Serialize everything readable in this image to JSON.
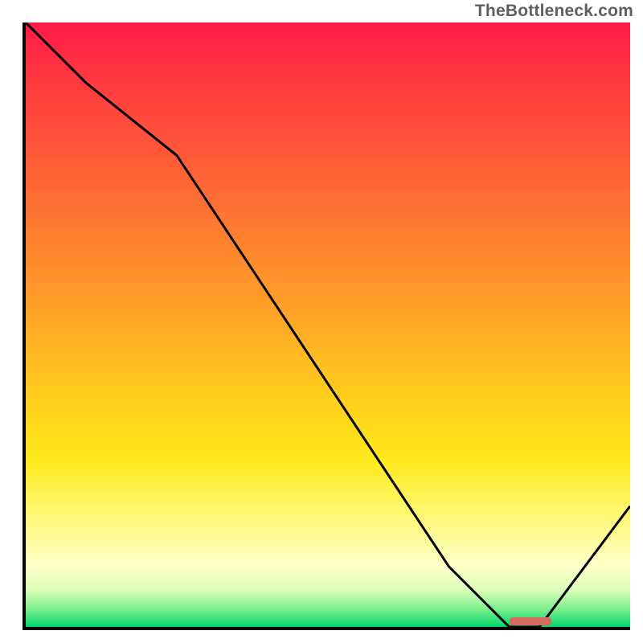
{
  "attribution": "TheBottleneck.com",
  "colors": {
    "curve": "#000000",
    "marker": "#d66a5e",
    "axis": "#000000"
  },
  "chart_data": {
    "type": "line",
    "title": "",
    "xlabel": "",
    "ylabel": "",
    "xlim": [
      0,
      100
    ],
    "ylim": [
      0,
      100
    ],
    "series": [
      {
        "name": "bottleneck-curve",
        "x": [
          0,
          10,
          25,
          70,
          80,
          85,
          100
        ],
        "y": [
          100,
          90,
          78,
          10,
          0,
          0,
          20
        ]
      }
    ],
    "marker": {
      "x_start": 80,
      "x_end": 87,
      "y": 0
    }
  }
}
